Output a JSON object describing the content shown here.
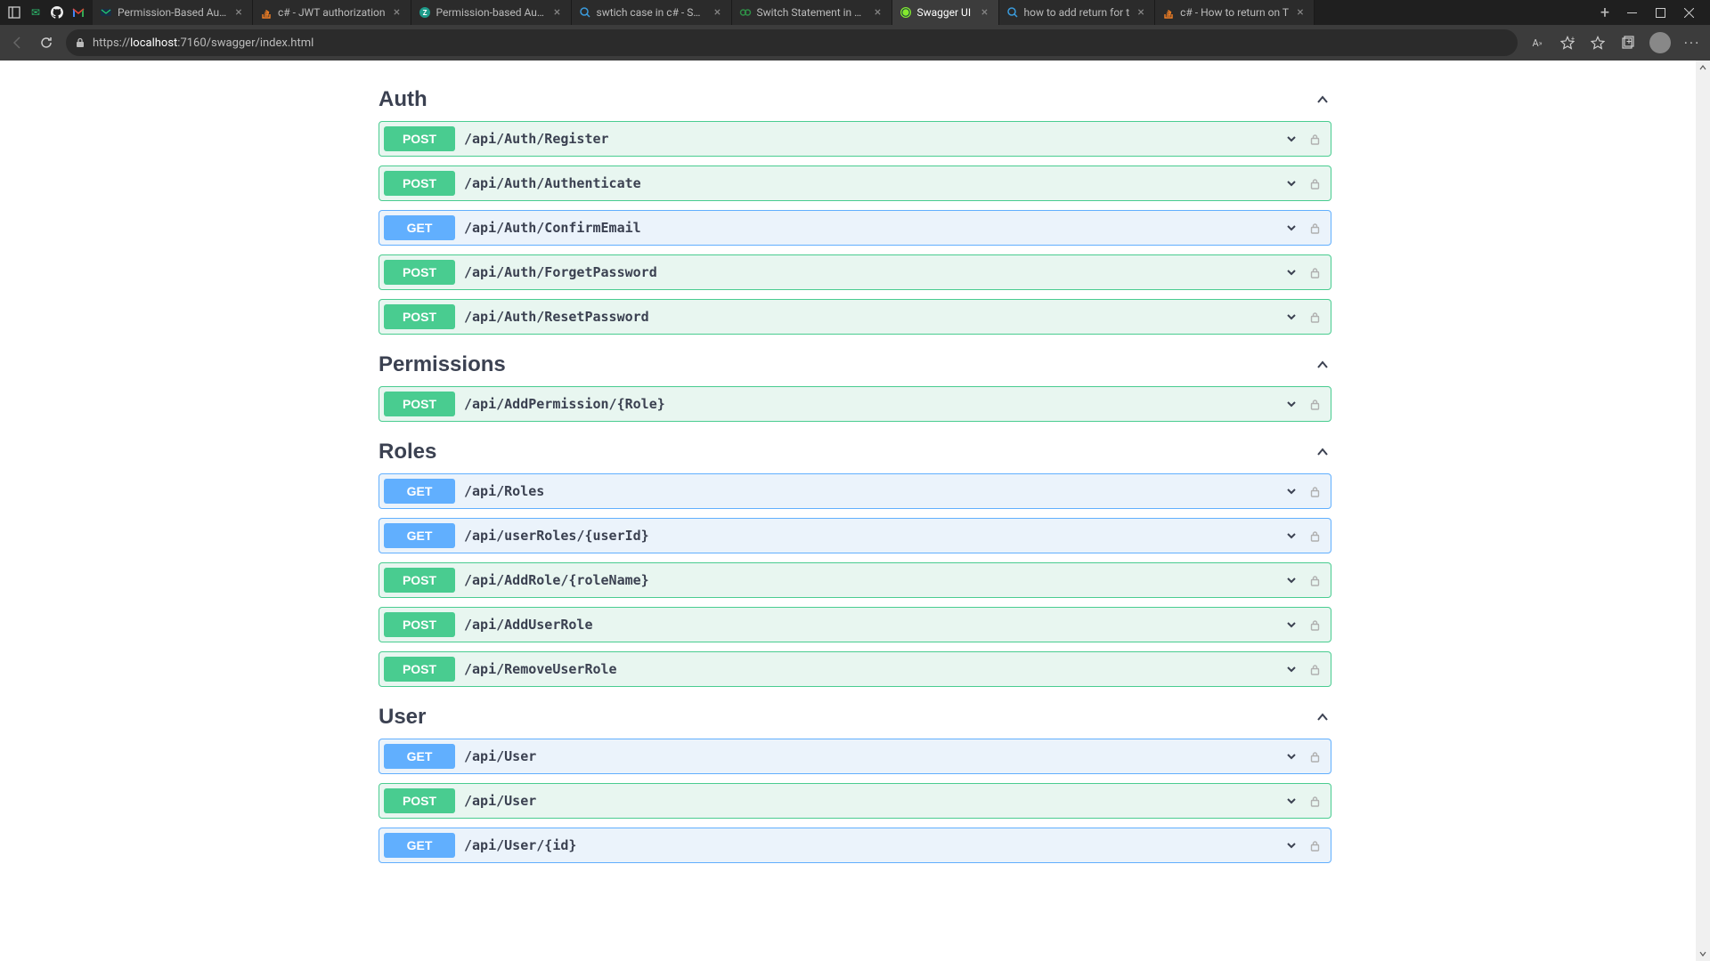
{
  "browser": {
    "url": {
      "prefix": "https://",
      "host": "localhost",
      "suffix": ":7160/swagger/index.html"
    },
    "tabs": [
      {
        "title": "Permission-Based Auth",
        "active": false,
        "favicon": "mailtrap"
      },
      {
        "title": "c# - JWT authorization",
        "active": false,
        "favicon": "stackoverflow"
      },
      {
        "title": "Permission-based Auth",
        "active": false,
        "favicon": "zehntech"
      },
      {
        "title": "swtich case in c# - Sear",
        "active": false,
        "favicon": "bing"
      },
      {
        "title": "Switch Statement in C#",
        "active": false,
        "favicon": "geeksforgeeks"
      },
      {
        "title": "Swagger UI",
        "active": true,
        "favicon": "swagger"
      },
      {
        "title": "how to add return for t",
        "active": false,
        "favicon": "bing"
      },
      {
        "title": "c# - How to return on T",
        "active": false,
        "favicon": "stackoverflow"
      }
    ],
    "titlebar_icons": [
      "sidebar",
      "mail-green",
      "github",
      "gmail"
    ]
  },
  "swagger": {
    "colors": {
      "post": "#49cc90",
      "get": "#61affe",
      "heading": "#3b4151"
    },
    "tags": [
      {
        "name": "Auth",
        "ops": [
          {
            "method": "POST",
            "path": "/api/Auth/Register"
          },
          {
            "method": "POST",
            "path": "/api/Auth/Authenticate"
          },
          {
            "method": "GET",
            "path": "/api/Auth/ConfirmEmail"
          },
          {
            "method": "POST",
            "path": "/api/Auth/ForgetPassword"
          },
          {
            "method": "POST",
            "path": "/api/Auth/ResetPassword"
          }
        ]
      },
      {
        "name": "Permissions",
        "ops": [
          {
            "method": "POST",
            "path": "/api/AddPermission/{Role}"
          }
        ]
      },
      {
        "name": "Roles",
        "ops": [
          {
            "method": "GET",
            "path": "/api/Roles"
          },
          {
            "method": "GET",
            "path": "/api/userRoles/{userId}"
          },
          {
            "method": "POST",
            "path": "/api/AddRole/{roleName}"
          },
          {
            "method": "POST",
            "path": "/api/AddUserRole"
          },
          {
            "method": "POST",
            "path": "/api/RemoveUserRole"
          }
        ]
      },
      {
        "name": "User",
        "ops": [
          {
            "method": "GET",
            "path": "/api/User"
          },
          {
            "method": "POST",
            "path": "/api/User"
          },
          {
            "method": "GET",
            "path": "/api/User/{id}"
          }
        ]
      }
    ]
  }
}
